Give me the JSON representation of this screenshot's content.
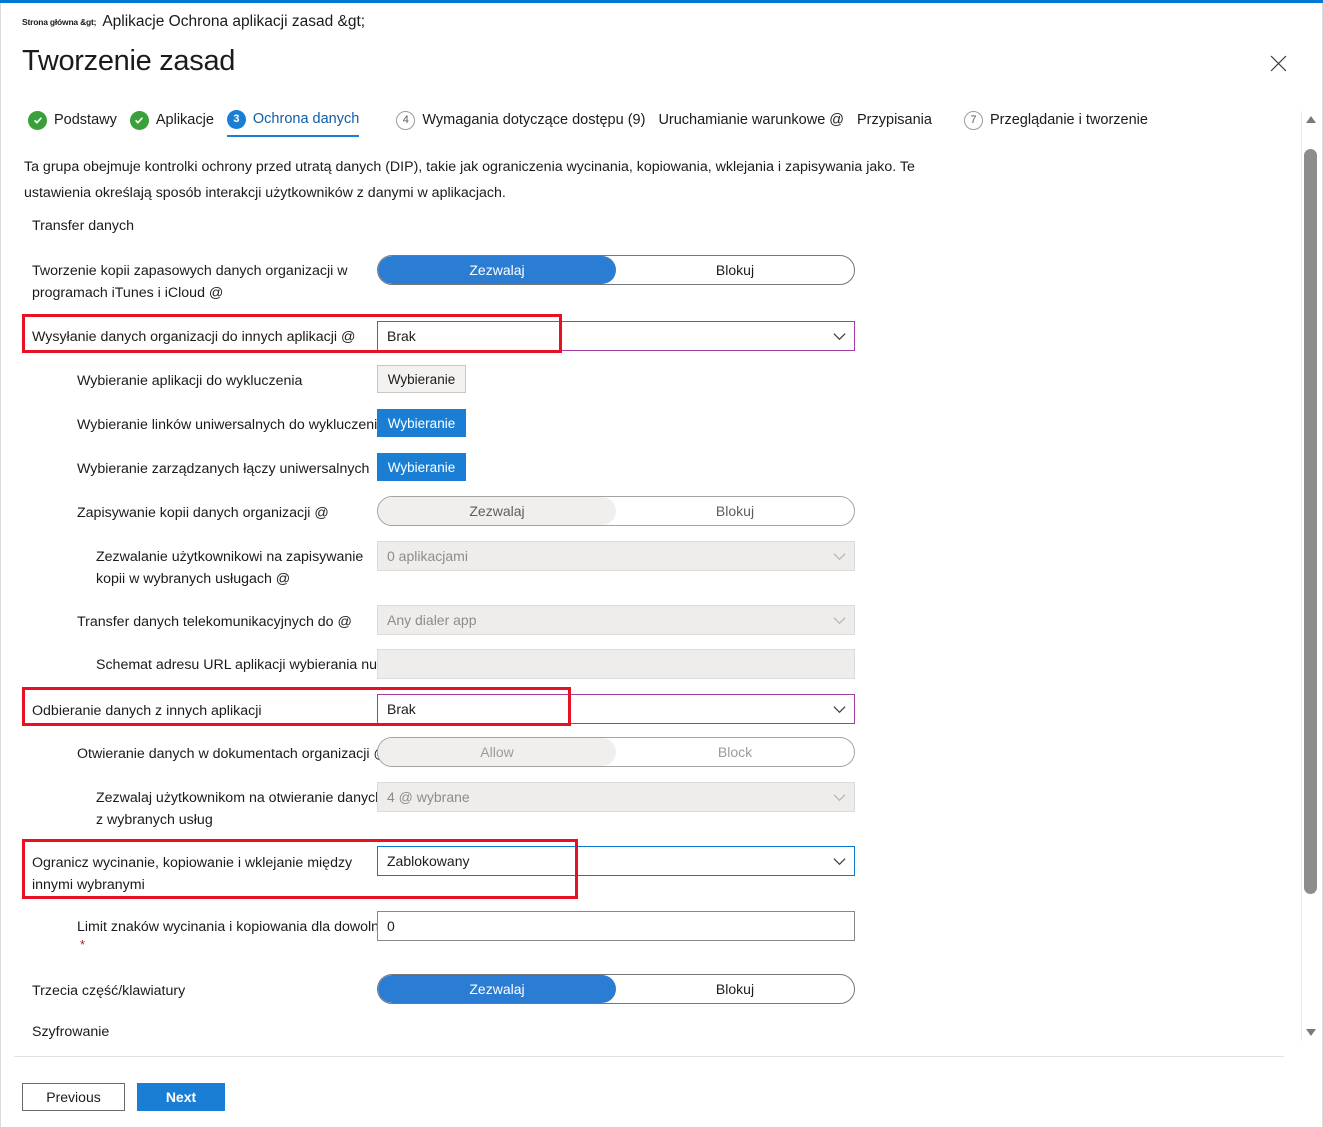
{
  "window": {
    "accent_color": "#0078d4",
    "close_icon": "close-icon"
  },
  "breadcrumb": {
    "small": "Strona główna &gt;",
    "main": "Aplikacje Ochrona aplikacji zasad &gt;"
  },
  "header": {
    "title": "Tworzenie zasad"
  },
  "steps": [
    {
      "badge": "check",
      "label": "Podstawy",
      "state": "done"
    },
    {
      "badge": "check",
      "label": "Aplikacje",
      "state": "done"
    },
    {
      "badge": "3",
      "label": "Ochrona danych",
      "state": "current"
    },
    {
      "badge": "4",
      "label": "Wymagania dotyczące dostępu (9)",
      "state": "pending"
    },
    {
      "badge": "",
      "label": "Uruchamianie warunkowe @",
      "state": "plain"
    },
    {
      "badge": "",
      "label": "Przypisania",
      "state": "plain"
    },
    {
      "badge": "7",
      "label": "Przeglądanie i tworzenie",
      "state": "pending"
    }
  ],
  "intro": "Ta grupa obejmuje kontrolki ochrony przed utratą danych (DIP), takie jak ograniczenia wycinania, kopiowania, wklejania i zapisywania jako. Te ustawienia określają sposób interakcji użytkowników z danymi w aplikacjach.",
  "sections": {
    "transfer": "Transfer danych",
    "encryption": "Szyfrowanie"
  },
  "fields": {
    "backup": {
      "label": "Tworzenie kopii zapasowych danych organizacji w programach iTunes i iCloud @",
      "allow": "Zezwalaj",
      "block": "Blokuj",
      "selected": "allow"
    },
    "send_org_data": {
      "label": "Wysyłanie danych organizacji do innych aplikacji @",
      "value": "Brak",
      "border_color": "#a23ba2"
    },
    "select_apps_exclude": {
      "label": "Wybieranie aplikacji do wykluczenia",
      "button": "Wybieranie"
    },
    "select_universal_links_exclude": {
      "label": "Wybieranie linków uniwersalnych do wykluczenia",
      "button": "Wybieranie"
    },
    "select_managed_universal_links": {
      "label": "Wybieranie zarządzanych łączy uniwersalnych",
      "button": "Wybieranie"
    },
    "save_copies": {
      "label": "Zapisywanie kopii danych organizacji @",
      "allow": "Zezwalaj",
      "block": "Blokuj",
      "selected": "allow"
    },
    "allow_user_save": {
      "label": "Zezwalanie użytkownikowi na zapisywanie kopii w wybranych usługach @",
      "value": "0 aplikacjami"
    },
    "telecom_transfer": {
      "label": "Transfer danych telekomunikacyjnych do @",
      "value": "Any dialer app"
    },
    "dialer_url": {
      "label": "Schemat adresu URL aplikacji wybierania numerów",
      "value": ""
    },
    "receive_data": {
      "label": "Odbieranie danych z innych aplikacji",
      "value": "Brak",
      "border_color": "#a23ba2"
    },
    "open_data_org_docs": {
      "label": "Otwieranie danych w dokumentach organizacji @",
      "allow": "Allow",
      "block": "Block",
      "selected": "allow"
    },
    "allow_user_open": {
      "label": "Zezwalaj użytkownikom na otwieranie danych z wybranych usług",
      "value": "4 @ wybrane"
    },
    "restrict_cut_copy_paste": {
      "label": "Ogranicz wycinanie, kopiowanie i wklejanie między innymi wybranymi",
      "value": "Zablokowany",
      "border_color": "#0b78d1"
    },
    "char_limit": {
      "label": "Limit znaków wycinania i kopiowania dla dowolnej aplikacji",
      "value": "0",
      "required_mark": "*"
    },
    "third_party_keyboards": {
      "label": "Trzecia część/klawiatury",
      "allow": "Zezwalaj",
      "block": "Blokuj",
      "selected": "allow"
    }
  },
  "annotations": {
    "color": "#e81123",
    "boxes": [
      "send-org-data",
      "receive-data",
      "restrict-cut-copy-paste"
    ]
  },
  "footer": {
    "previous": "Previous",
    "next": "Next"
  },
  "scrollbar": {
    "up_icon": "caret-up-icon",
    "down_icon": "caret-down-icon"
  }
}
